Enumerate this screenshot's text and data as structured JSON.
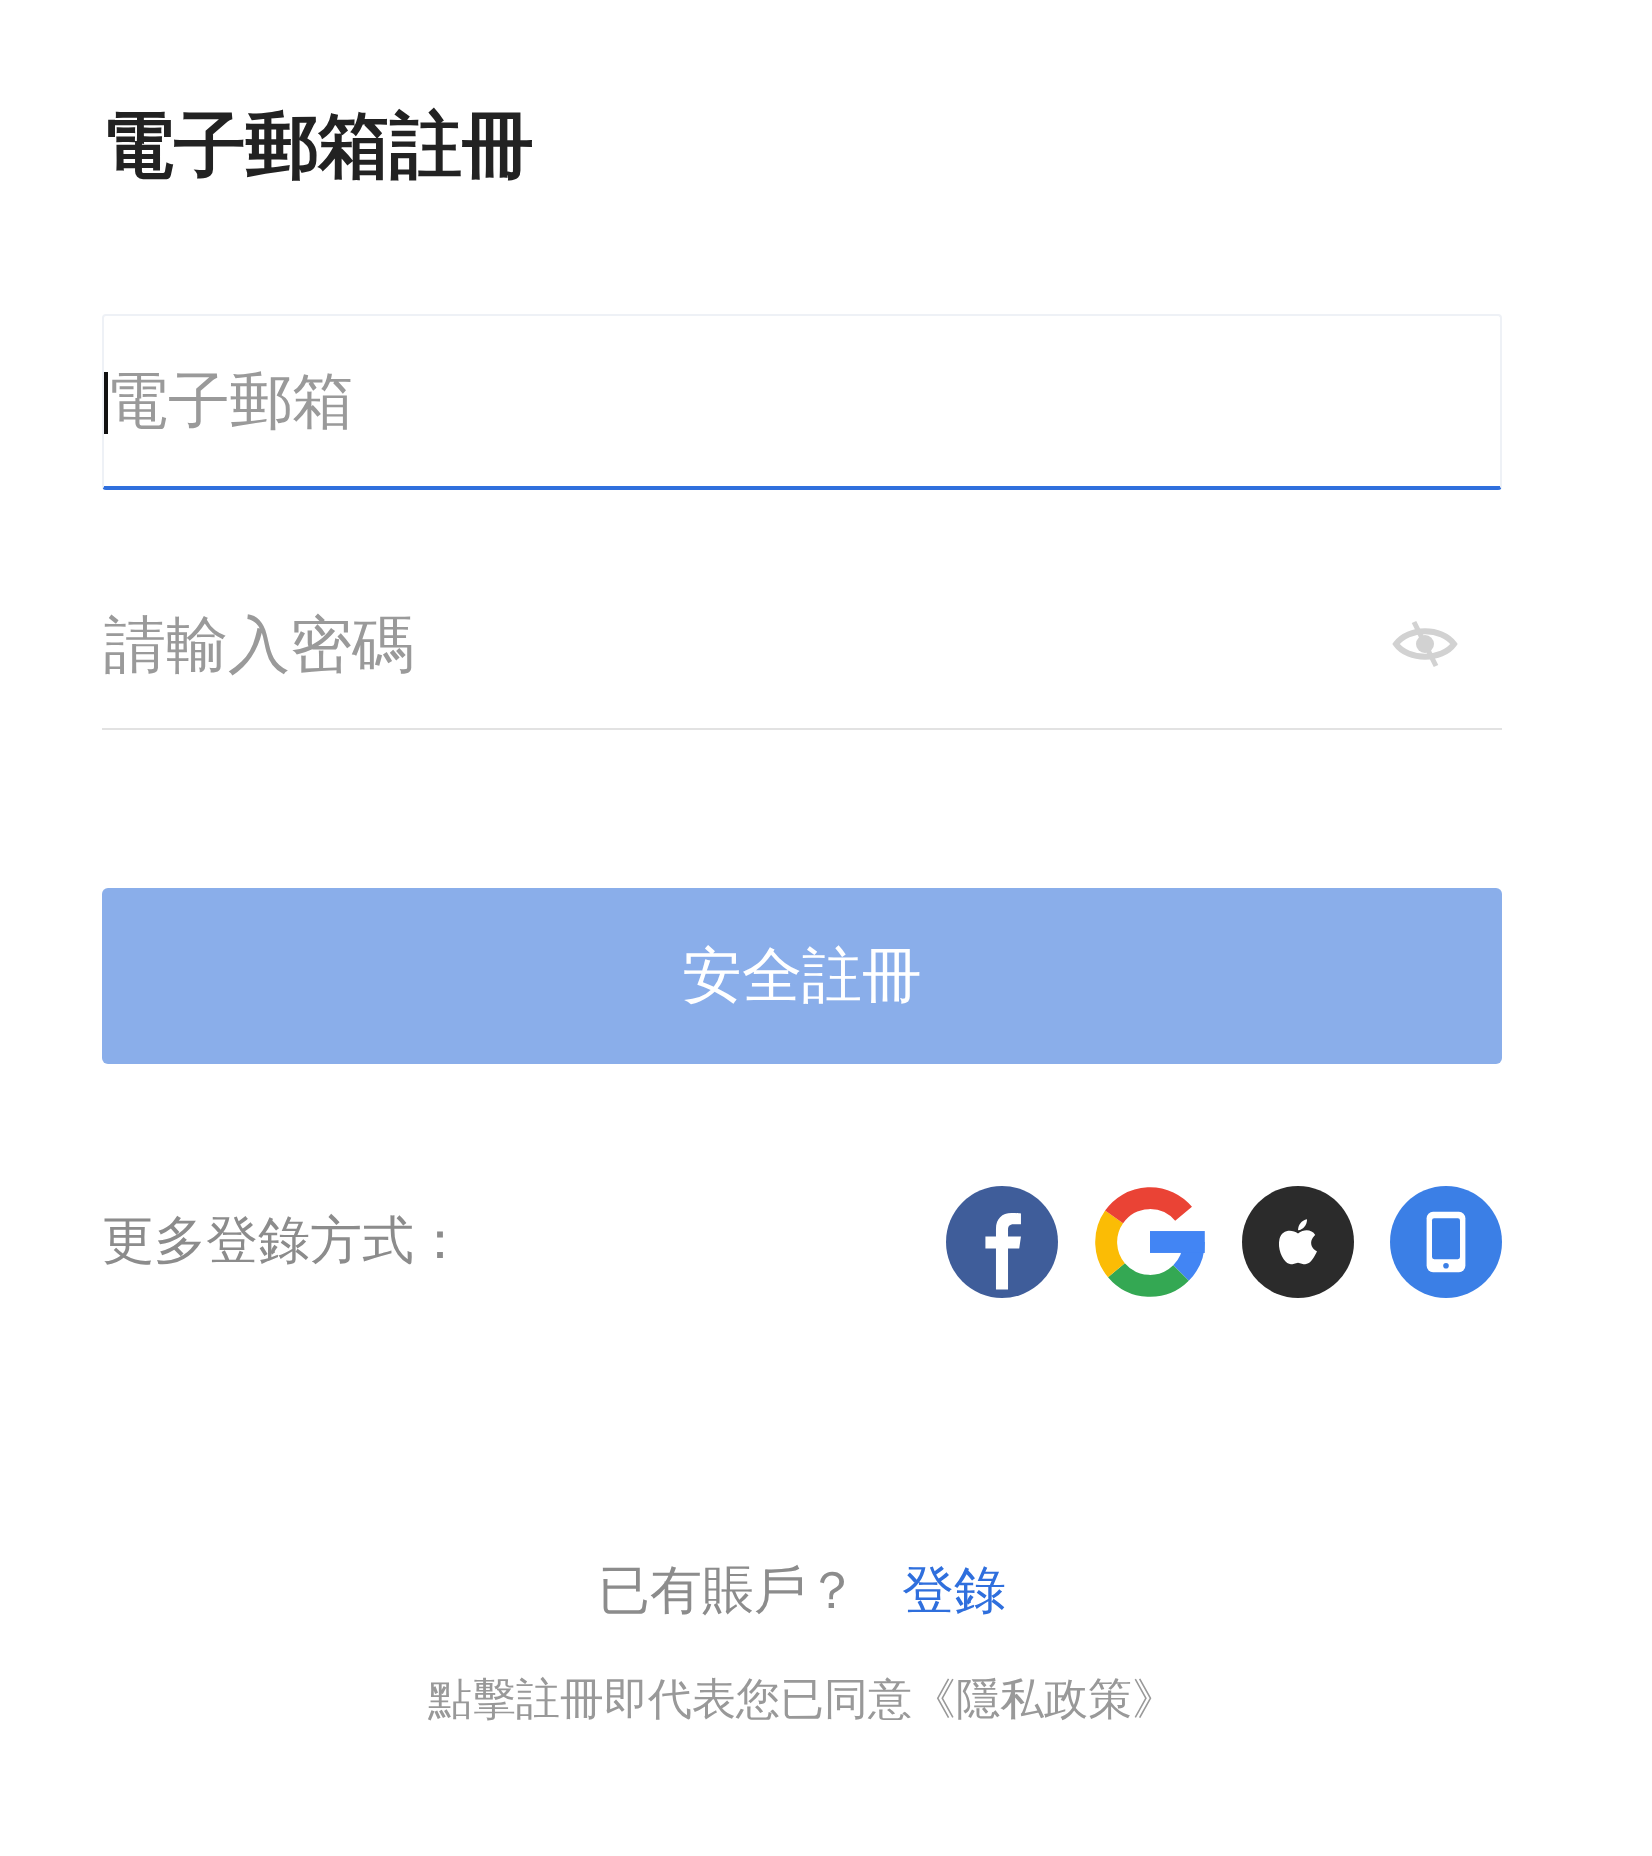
{
  "title": "電子郵箱註冊",
  "fields": [
    {
      "kind": "email",
      "placeholder": "電子郵箱",
      "focused": true
    },
    {
      "kind": "password",
      "placeholder": "請輸入密碼",
      "focused": false
    }
  ],
  "submit_button": {
    "label": "安全註冊",
    "disabled": true
  },
  "more_login": {
    "label": "更多登錄方式：",
    "providers": [
      {
        "kind": "facebook"
      },
      {
        "kind": "google"
      },
      {
        "kind": "apple"
      },
      {
        "kind": "phone"
      }
    ]
  },
  "account_prompt": {
    "text": "已有賬戶？",
    "link": "登錄"
  },
  "policy": "點擊註冊即代表您已同意《隱私政策》"
}
